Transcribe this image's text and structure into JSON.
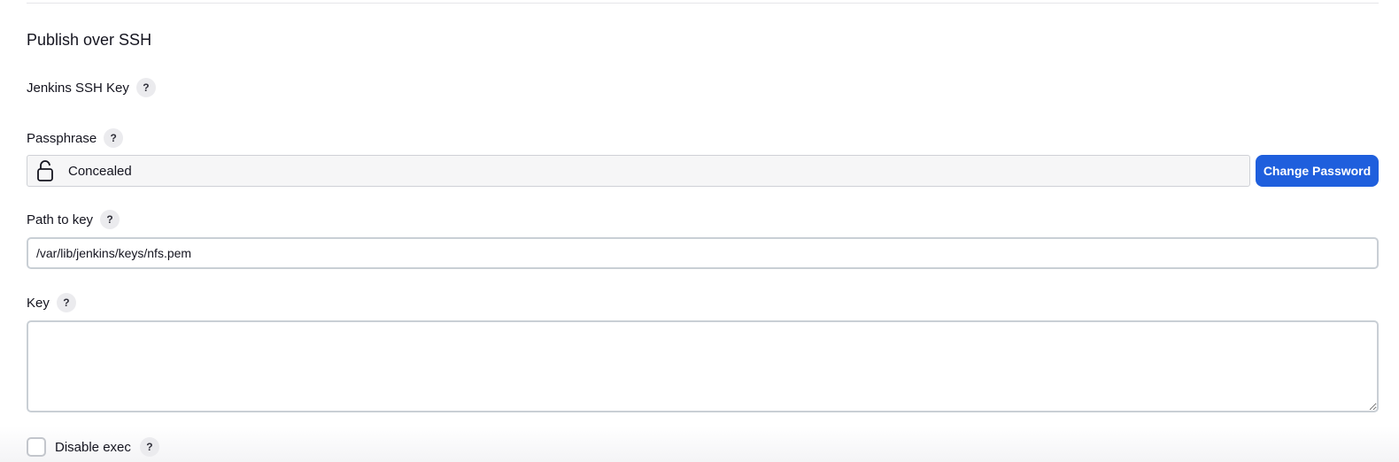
{
  "section": {
    "title": "Publish over SSH"
  },
  "fields": {
    "jenkins_ssh_key": {
      "label": "Jenkins SSH Key",
      "help": "?"
    },
    "passphrase": {
      "label": "Passphrase",
      "help": "?",
      "value": "Concealed",
      "button_label": "Change Password",
      "icon": "lock-icon"
    },
    "path_to_key": {
      "label": "Path to key",
      "help": "?",
      "value": "/var/lib/jenkins/keys/nfs.pem"
    },
    "key": {
      "label": "Key",
      "help": "?",
      "value": ""
    },
    "disable_exec": {
      "label": "Disable exec",
      "help": "?",
      "checked": false
    }
  },
  "colors": {
    "accent": "#1f5fdd",
    "text": "#14141f",
    "help_bg": "#ebebee",
    "input_border": "#c9cfd5"
  }
}
